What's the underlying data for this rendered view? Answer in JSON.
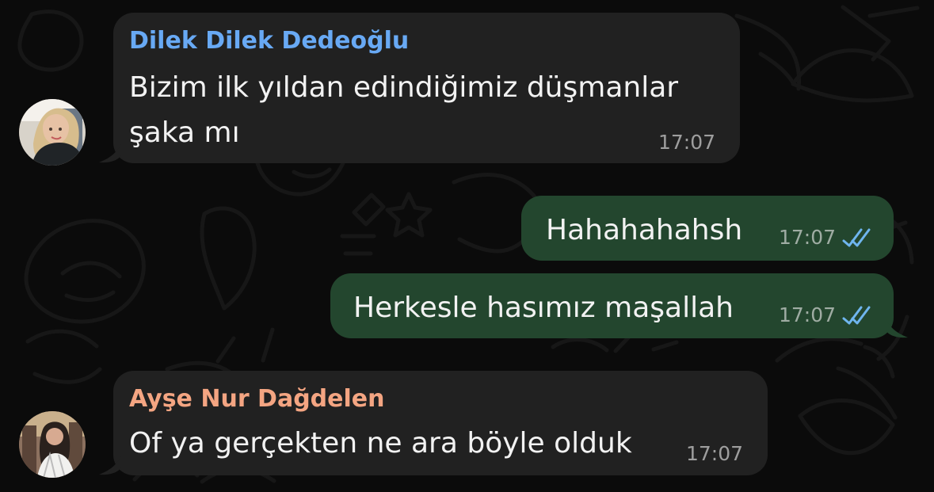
{
  "messages": [
    {
      "sender": "Dilek Dilek Dedeoğlu",
      "text": "Bizim ilk yıldan edindiğimiz düşmanlar\nşaka mı",
      "time": "17:07",
      "direction": "incoming",
      "avatar": "profile-photo-woman-headscarf"
    },
    {
      "text": "Hahahahahsh",
      "time": "17:07",
      "direction": "outgoing",
      "status_icon": "double-check-icon"
    },
    {
      "text": "Herkesle hasımız maşallah",
      "time": "17:07",
      "direction": "outgoing",
      "status_icon": "double-check-icon"
    },
    {
      "sender": "Ayşe Nur Dağdelen",
      "text": "Of ya gerçekten ne ara böyle olduk",
      "time": "17:07",
      "direction": "incoming",
      "avatar": "profile-photo-woman"
    }
  ],
  "colors": {
    "background": "#0b0b0b",
    "incoming_bubble": "#212121",
    "outgoing_bubble": "#23462e",
    "sender_dilek": "#68a9f4",
    "sender_ayse": "#f4a582",
    "read_check": "#6fb5ee"
  }
}
